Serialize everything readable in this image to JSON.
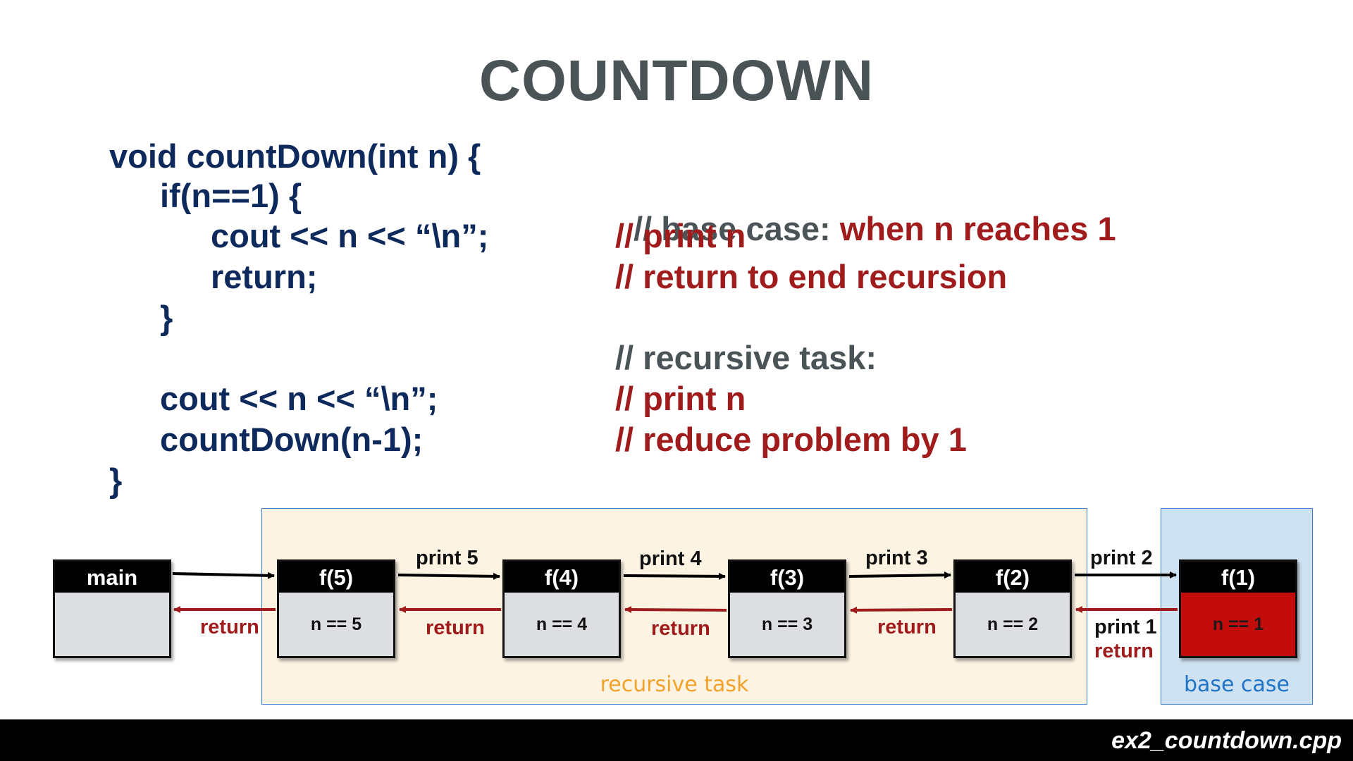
{
  "title": "COUNTDOWN",
  "code": {
    "line1": "void countDown(int n) {",
    "line2": "if(n==1) {",
    "line3": "cout << n << “\\n”;",
    "line4": "return;",
    "line5": "}",
    "line6": "cout << n << “\\n”;",
    "line7": "countDown(n-1);",
    "line8": "}"
  },
  "comments": {
    "base_case_prefix": "// base case: ",
    "base_case_rest": "when n reaches 1",
    "print_n_1": "// print n",
    "return_end": "// return to end recursion",
    "recursive_task": "// recursive task:",
    "print_n_2": "// print n",
    "reduce": "// reduce problem by 1"
  },
  "diagram": {
    "frames": [
      {
        "name": "main",
        "body": ""
      },
      {
        "name": "f(5)",
        "body": "n == 5"
      },
      {
        "name": "f(4)",
        "body": "n == 4"
      },
      {
        "name": "f(3)",
        "body": "n == 3"
      },
      {
        "name": "f(2)",
        "body": "n == 2"
      },
      {
        "name": "f(1)",
        "body": "n == 1"
      }
    ],
    "call_labels": [
      "print 5",
      "print 4",
      "print 3",
      "print 2"
    ],
    "return_label": "return",
    "base_print_label": "print 1",
    "recursive_region_label": "recursive task",
    "base_region_label": "base case",
    "colors": {
      "call_arrow": "#000000",
      "return_arrow": "#a01c1c",
      "base_frame": "#c30d0d",
      "recursive_region": "#fdf3e3",
      "base_region": "#cfe2f2"
    }
  },
  "footer": {
    "filename": "ex2_countdown.cpp"
  }
}
